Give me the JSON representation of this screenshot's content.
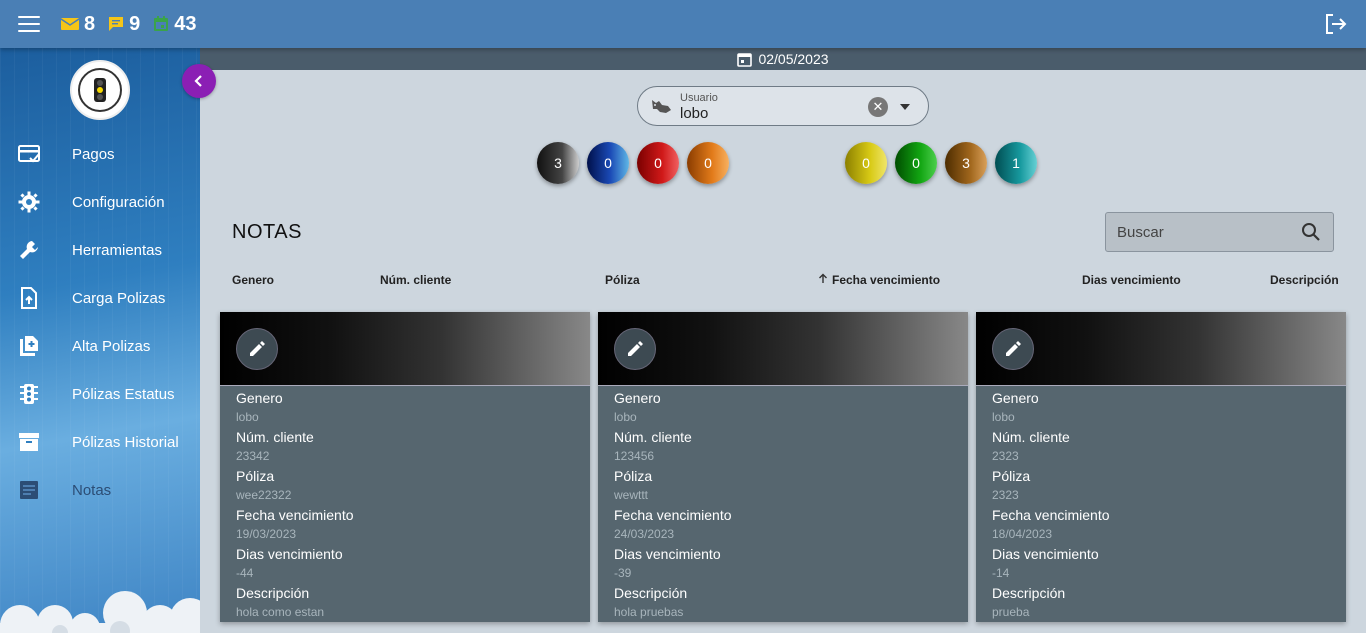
{
  "topbar": {
    "mail_count": "8",
    "chat_count": "9",
    "calendar_count": "43"
  },
  "date": "02/05/2023",
  "sidebar": {
    "items": [
      {
        "label": "Pagos",
        "icon": "payment-check-icon"
      },
      {
        "label": "Configuración",
        "icon": "gear-icon"
      },
      {
        "label": "Herramientas",
        "icon": "wrench-icon"
      },
      {
        "label": "Carga Polizas",
        "icon": "file-upload-icon"
      },
      {
        "label": "Alta Polizas",
        "icon": "file-add-icon"
      },
      {
        "label": "Pólizas Estatus",
        "icon": "traffic-light-icon"
      },
      {
        "label": "Pólizas Historial",
        "icon": "archive-icon"
      },
      {
        "label": "Notas",
        "icon": "notes-icon"
      }
    ]
  },
  "filter": {
    "label": "Usuario",
    "value": "lobo"
  },
  "status_counts": {
    "black": "3",
    "blue": "0",
    "red": "0",
    "orange": "0",
    "yellow": "0",
    "green": "0",
    "brown": "3",
    "teal": "1"
  },
  "section_title": "NOTAS",
  "search": {
    "placeholder": "Buscar"
  },
  "columns": [
    "Genero",
    "Núm. cliente",
    "Póliza",
    "Fecha vencimiento",
    "Dias vencimiento",
    "Descripción"
  ],
  "cards": [
    {
      "genero": "lobo",
      "num_cliente": "23342",
      "poliza": "wee22322",
      "fecha_vencimiento": "19/03/2023",
      "dias_vencimiento": "-44",
      "descripcion": "hola como estan"
    },
    {
      "genero": "lobo",
      "num_cliente": "123456",
      "poliza": "wewttt",
      "fecha_vencimiento": "24/03/2023",
      "dias_vencimiento": "-39",
      "descripcion": "hola pruebas"
    },
    {
      "genero": "lobo",
      "num_cliente": "2323",
      "poliza": "2323",
      "fecha_vencimiento": "18/04/2023",
      "dias_vencimiento": "-14",
      "descripcion": "prueba"
    }
  ],
  "colors": {
    "topbar": "#4a7fb5",
    "accent_purple": "#8b1fb4",
    "card_bg": "#56666f"
  }
}
